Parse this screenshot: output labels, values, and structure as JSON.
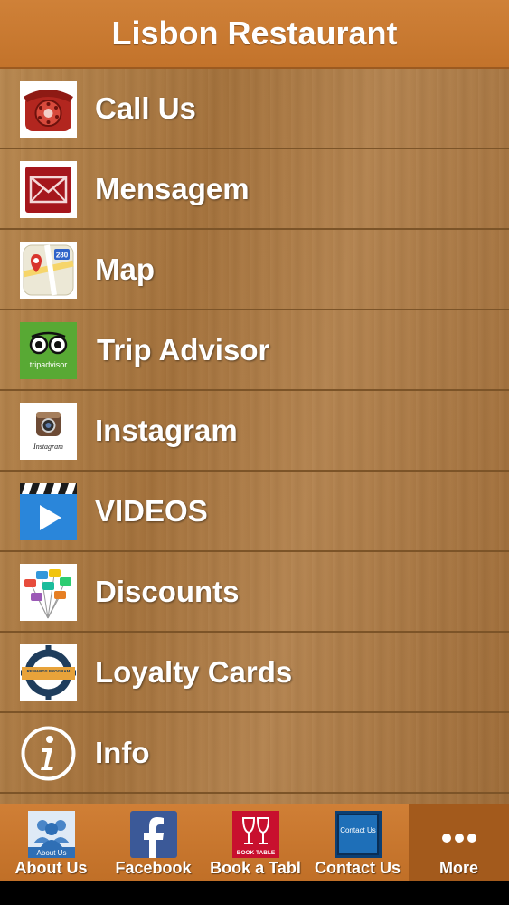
{
  "header": {
    "title": "Lisbon Restaurant"
  },
  "menu": [
    {
      "label": "Call Us",
      "icon": "telephone-icon"
    },
    {
      "label": "Mensagem",
      "icon": "envelope-icon"
    },
    {
      "label": "Map",
      "icon": "map-icon"
    },
    {
      "label": "Trip Advisor",
      "icon": "tripadvisor-icon",
      "icon_text": "tripadvisor"
    },
    {
      "label": "Instagram",
      "icon": "instagram-icon",
      "icon_text": "Instagram"
    },
    {
      "label": "VIDEOS",
      "icon": "video-play-icon"
    },
    {
      "label": "Discounts",
      "icon": "discount-tags-icon"
    },
    {
      "label": "Loyalty Cards",
      "icon": "rewards-badge-icon",
      "icon_text": "REWARDS PROGRAM"
    },
    {
      "label": "Info",
      "icon": "info-icon"
    }
  ],
  "map_icon_text": "280",
  "tabs": [
    {
      "label": "About Us",
      "icon": "about-us-icon",
      "icon_text": "About Us"
    },
    {
      "label": "Facebook",
      "icon": "facebook-icon"
    },
    {
      "label": "Book a Tabl",
      "icon": "book-table-icon",
      "icon_text": "BOOK TABLE"
    },
    {
      "label": "Contact Us",
      "icon": "contact-us-icon",
      "icon_text": "Contact Us"
    },
    {
      "label": "More",
      "icon": "more-dots-icon"
    }
  ],
  "colors": {
    "header": "#c97a31",
    "tabbar": "#c8772d",
    "tab_active": "#a35a1c",
    "wood": "#a97a45"
  }
}
